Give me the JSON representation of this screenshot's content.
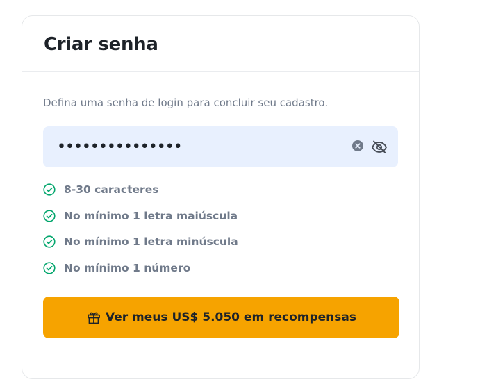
{
  "header": {
    "title": "Criar senha"
  },
  "form": {
    "subtitle": "Defina uma senha de login para concluir seu cadastro.",
    "password": {
      "masked_value": "•••••••••••••••",
      "clear_icon": "clear-circle-icon",
      "visibility_icon": "eye-off-icon"
    },
    "rules": [
      {
        "label": "8-30 caracteres",
        "status": "met"
      },
      {
        "label": "No mínimo 1 letra maiúscula",
        "status": "met"
      },
      {
        "label": "No mínimo 1 letra minúscula",
        "status": "met"
      },
      {
        "label": "No mínimo 1 número",
        "status": "met"
      }
    ],
    "submit": {
      "label": "Ver meus US$ 5.050 em recompensas",
      "icon": "gift-icon"
    }
  },
  "colors": {
    "accent": "#f6a300",
    "field_bg": "#e8f0fe",
    "check_green": "#03a66d",
    "muted_text": "#707a8a",
    "primary_text": "#1e2329"
  }
}
